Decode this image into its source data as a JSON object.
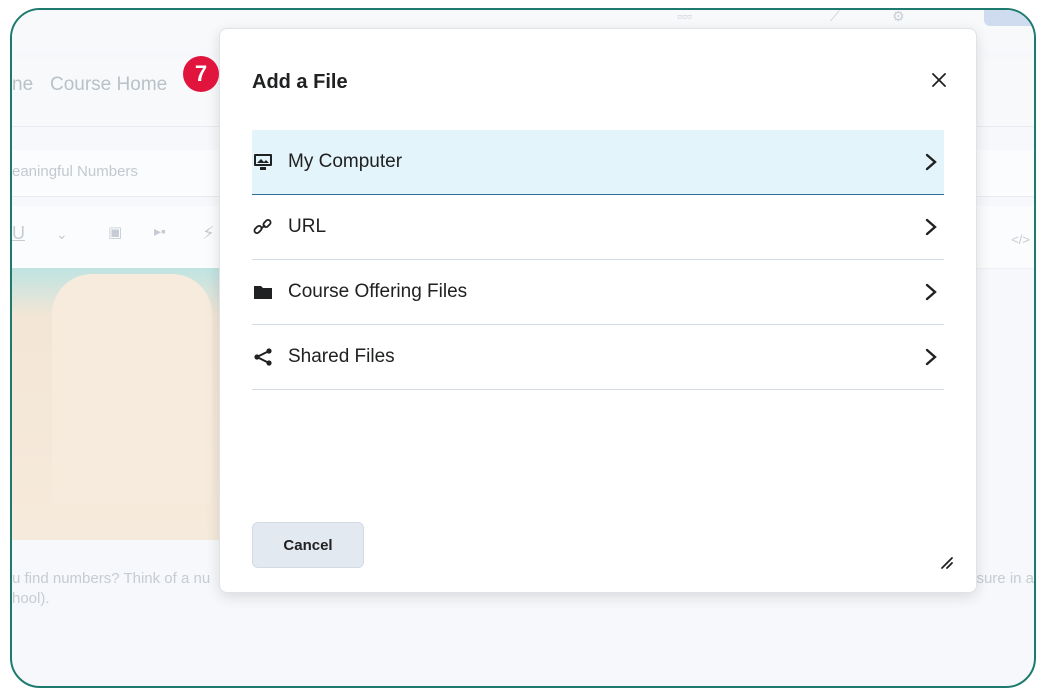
{
  "background": {
    "nav_left_fragment": "ne",
    "nav_course_home": "Course Home",
    "title_fragment": "eaningful Numbers",
    "para_line1_left": "u find numbers? Think of a nu",
    "para_line2_left": "hool).",
    "para_line1_right": "asure in a",
    "code_icon": "</>"
  },
  "step_badge": "7",
  "dialog": {
    "title": "Add a File",
    "close_icon": "close-icon",
    "items": [
      {
        "label": "My Computer",
        "icon": "computer-icon",
        "selected": true
      },
      {
        "label": "URL",
        "icon": "link-icon",
        "selected": false
      },
      {
        "label": "Course Offering Files",
        "icon": "folder-icon",
        "selected": false
      },
      {
        "label": "Shared Files",
        "icon": "share-icon",
        "selected": false
      }
    ],
    "cancel_label": "Cancel"
  },
  "colors": {
    "frame_border": "#1e7a6e",
    "badge": "#e0143c",
    "selected_row": "#e3f4fb",
    "selected_border": "#2c6e94",
    "cancel_bg": "#e3e9f1"
  }
}
